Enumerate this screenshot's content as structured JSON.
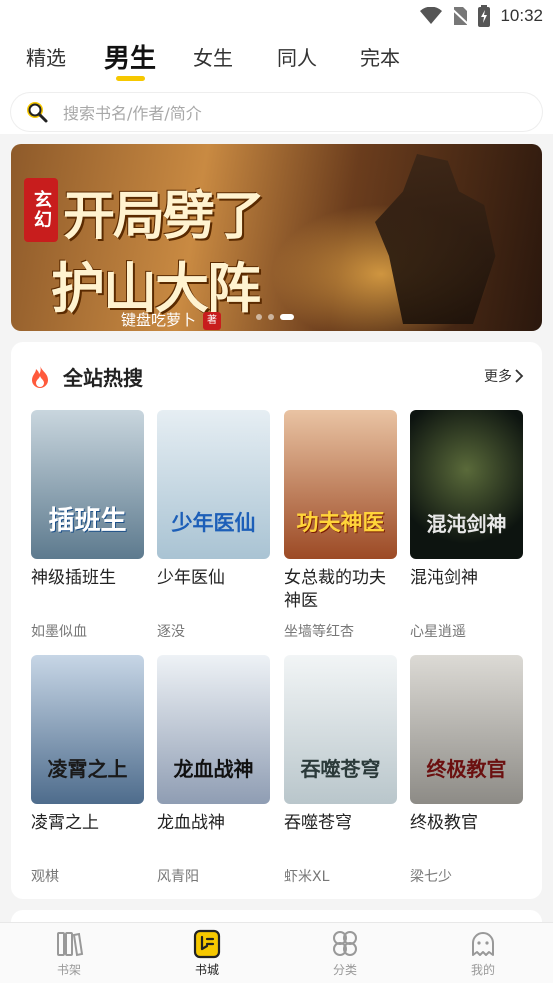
{
  "status_bar": {
    "time": "10:32"
  },
  "tabs": [
    {
      "label": "精选",
      "active": false
    },
    {
      "label": "男生",
      "active": true
    },
    {
      "label": "女生",
      "active": false
    },
    {
      "label": "同人",
      "active": false
    },
    {
      "label": "完本",
      "active": false
    }
  ],
  "search": {
    "placeholder": "搜索书名/作者/简介",
    "icon": "search-icon"
  },
  "banner": {
    "tag": "玄幻",
    "title_line1": "开局劈了",
    "title_line2": "护山大阵",
    "author": "键盘吃萝卜",
    "seal": "著",
    "slides": 3,
    "active_slide": 3
  },
  "hot_section": {
    "title": "全站热搜",
    "more_label": "更多",
    "icon": "fire-icon",
    "books": [
      {
        "name": "神级插班生",
        "author": "如墨似血",
        "cover_text": "插班生",
        "cover_bg": "#8aa6b8"
      },
      {
        "name": "少年医仙",
        "author": "逐没",
        "cover_text": "少年医仙",
        "cover_bg": "#c8dde8"
      },
      {
        "name": "女总裁的功夫神医",
        "author": "坐墙等红杏",
        "cover_text": "功夫神医",
        "cover_bg": "#c27a4d"
      },
      {
        "name": "混沌剑神",
        "author": "心星逍遥",
        "cover_text": "混沌剑神",
        "cover_bg": "#1f2a24"
      },
      {
        "name": "凌霄之上",
        "author": "观棋",
        "cover_text": "凌霄之上",
        "cover_bg": "#6f8aa5"
      },
      {
        "name": "龙血战神",
        "author": "风青阳",
        "cover_text": "龙血战神",
        "cover_bg": "#a9b4c4"
      },
      {
        "name": "吞噬苍穹",
        "author": "虾米XL",
        "cover_text": "吞噬苍穹",
        "cover_bg": "#d9e1e4"
      },
      {
        "name": "终极教官",
        "author": "梁七少",
        "cover_text": "终极教官",
        "cover_bg": "#b9b7b1"
      }
    ]
  },
  "bottom_nav": [
    {
      "label": "书架",
      "icon": "bookshelf-icon",
      "active": false
    },
    {
      "label": "书城",
      "icon": "bookstore-icon",
      "active": true
    },
    {
      "label": "分类",
      "icon": "category-icon",
      "active": false
    },
    {
      "label": "我的",
      "icon": "profile-icon",
      "active": false
    }
  ],
  "colors": {
    "accent": "#f6c800",
    "fire": "#ff5a3c"
  }
}
